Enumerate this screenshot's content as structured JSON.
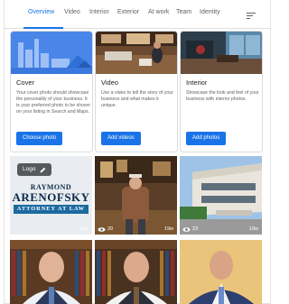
{
  "tabs": [
    {
      "label": "Overview",
      "active": true
    },
    {
      "label": "Video",
      "active": false
    },
    {
      "label": "Interior",
      "active": false
    },
    {
      "label": "Exterior",
      "active": false
    },
    {
      "label": "At work",
      "active": false
    },
    {
      "label": "Team",
      "active": false
    },
    {
      "label": "Identity",
      "active": false
    }
  ],
  "filter_icon": "filter-lines-icon",
  "cards": [
    {
      "title": "Cover",
      "description": "Your cover photo should showcase the personality of your business. It is your preferred photo to be shown on your listing in Search and Maps.",
      "button": "Choose photo"
    },
    {
      "title": "Video",
      "description": "Use a video to tell the story of your business and what makes it unique.",
      "button": "Add videos"
    },
    {
      "title": "Interior",
      "description": "Showcase the look and feel of your business with interior photos.",
      "button": "Add photos"
    }
  ],
  "photos": [
    {
      "kind": "logo",
      "chip_label": "Logo",
      "logo_line1": "RAYMOND",
      "logo_line2": "ARENOFSKY",
      "logo_line3": "ATTORNEY AT LAW",
      "views": "",
      "age": "19w"
    },
    {
      "kind": "office",
      "views": "20",
      "age": "19w"
    },
    {
      "kind": "building",
      "views": "23",
      "age": "19w"
    },
    {
      "kind": "portrait-books",
      "views": "",
      "age": ""
    },
    {
      "kind": "portrait-books",
      "views": "",
      "age": ""
    },
    {
      "kind": "portrait-plain",
      "views": "",
      "age": ""
    }
  ],
  "colors": {
    "accent": "#1a73e8",
    "logo_band": "#1d6aa0"
  }
}
